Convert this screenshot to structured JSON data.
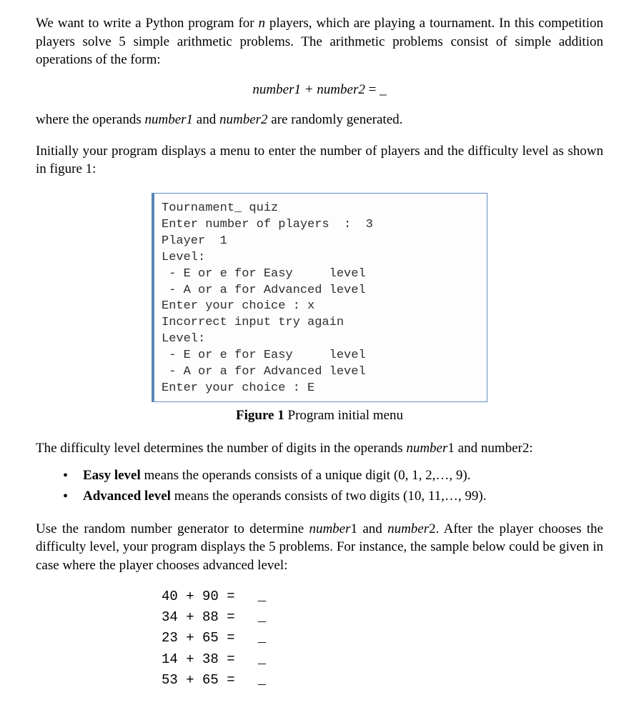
{
  "intro": {
    "p1_a": "We want to write a Python program for ",
    "p1_n": "n",
    "p1_b": " players, which are playing a tournament. In this competition players solve 5 simple arithmetic problems. The arithmetic problems consist of simple addition operations of the form:"
  },
  "formula": {
    "lhs": "number1 + number2",
    "eq": " = ",
    "blank": "_"
  },
  "operands_sentence": {
    "a": "where the operands ",
    "n1": "number1",
    "mid": " and ",
    "n2": "number2",
    "b": " are randomly generated."
  },
  "menu_intro": "Initially your program displays a menu to enter the number of players and the difficulty level as shown in figure 1:",
  "terminal": {
    "l1": "Tournament_ quiz",
    "l2": "",
    "l3": "Enter number of players  :  3",
    "l4": "",
    "l5": "Player  1",
    "l6": "",
    "l7": "Level:",
    "l8": " - E or e for Easy     level",
    "l9": " - A or a for Advanced level",
    "l10": "",
    "l11": "Enter your choice : x",
    "l12": "Incorrect input try again",
    "l13": "",
    "l14": "Level:",
    "l15": " - E or e for Easy     level",
    "l16": " - A or a for Advanced level",
    "l17": "",
    "l18": "Enter your choice : E"
  },
  "caption": {
    "bold": "Figure 1",
    "rest": "  Program initial menu"
  },
  "difficulty_sentence": {
    "a": "The difficulty level determines the number of digits in the operands ",
    "n1": "number",
    "n1sub": "1 and number",
    "n2sub": "2:"
  },
  "levels": {
    "easy": {
      "label": "Easy level",
      "rest": " means the operands consists of a unique digit (0, 1, 2,…, 9)."
    },
    "adv": {
      "label": "Advanced  level",
      "rest": "  means  the  operands  consists  of  two  digits  (10,  11,…,  99)."
    }
  },
  "rng_para": {
    "a": "Use the random number generator to determine ",
    "n1": "number",
    "one": "1 and ",
    "n2": "number",
    "two": "2.  After the player chooses the difficulty level, your program displays the 5 problems. For instance, the sample below could be given in case where the player chooses advanced level:"
  },
  "problems": {
    "r1": {
      "a": "40",
      "b": "90",
      "blank": "_"
    },
    "r2": {
      "a": "34",
      "b": "88",
      "blank": "_"
    },
    "r3": {
      "a": "23",
      "b": "65",
      "blank": "_"
    },
    "r4": {
      "a": "14",
      "b": "38",
      "blank": "_"
    },
    "r5": {
      "a": "53",
      "b": "65",
      "blank": "_"
    }
  }
}
